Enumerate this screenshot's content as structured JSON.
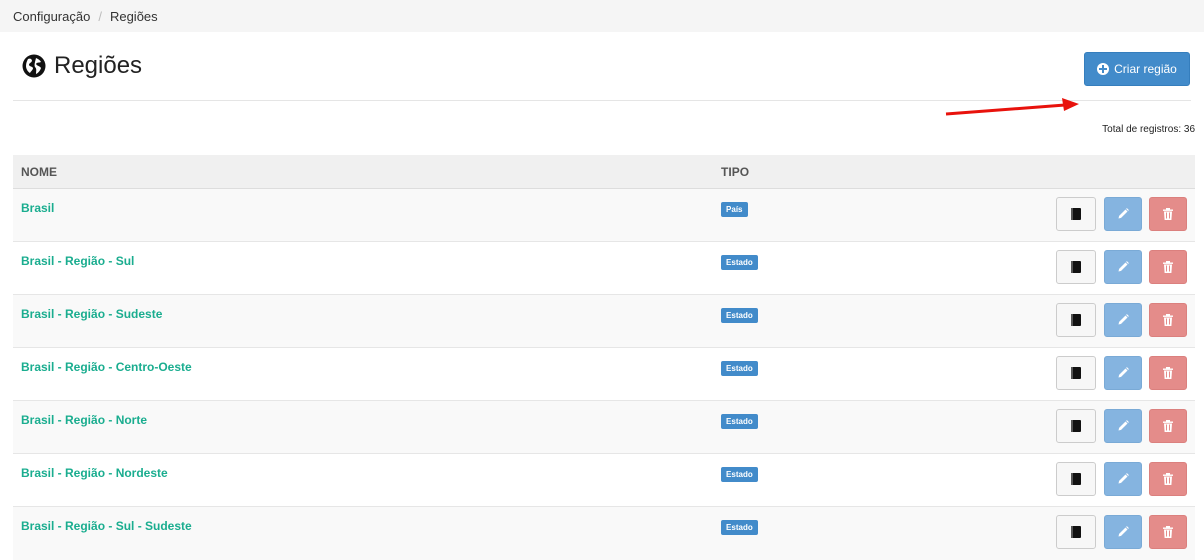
{
  "breadcrumb": {
    "items": [
      "Configuração",
      "Regiões"
    ],
    "separator": "/"
  },
  "page": {
    "title": "Regiões",
    "create_button": "Criar região",
    "total": "Total de registros: 36"
  },
  "table": {
    "headers": {
      "name": "NOME",
      "type": "TIPO"
    },
    "rows": [
      {
        "name": "Brasil",
        "type": "País"
      },
      {
        "name": "Brasil - Região - Sul",
        "type": "Estado"
      },
      {
        "name": "Brasil - Região - Sudeste",
        "type": "Estado"
      },
      {
        "name": "Brasil - Região - Centro-Oeste",
        "type": "Estado"
      },
      {
        "name": "Brasil - Região - Norte",
        "type": "Estado"
      },
      {
        "name": "Brasil - Região - Nordeste",
        "type": "Estado"
      },
      {
        "name": "Brasil - Região - Sul - Sudeste",
        "type": "Estado"
      }
    ]
  },
  "icons": {
    "title": "globe-icon",
    "create": "plus-circle-icon",
    "view": "book-icon",
    "edit": "pencil-icon",
    "delete": "trash-icon",
    "annotation": "red-arrow"
  },
  "colors": {
    "primary": "#428bca",
    "link": "#1aad8f",
    "edit": "#85b4e0",
    "delete": "#e48c8a",
    "arrow": "#e8120c"
  }
}
